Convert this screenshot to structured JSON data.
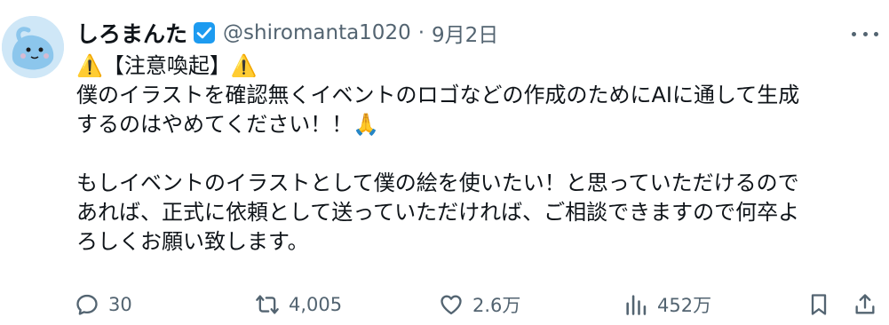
{
  "tweet": {
    "author_name": "しろまんた",
    "handle": "@shiromanta1020",
    "separator": "·",
    "date": "9月2日",
    "lines": [
      "⚠️【注意喚起】⚠️",
      "僕のイラストを確認無くイベントのロゴなどの作成のためにAIに通して生成",
      "するのはやめてください！！🙏",
      "",
      "もしイベントのイラストとして僕の絵を使いたい！と思っていただけるので",
      "あれば、正式に依頼として送っていただければ、ご相談できますので何卒よ",
      "ろしくお願い致します。"
    ]
  },
  "actions": {
    "replies": "30",
    "retweets": "4,005",
    "likes": "2.6万",
    "views": "452万"
  },
  "icons": {
    "more": "more-horizontal-icon",
    "reply": "reply-icon",
    "retweet": "retweet-icon",
    "like": "heart-icon",
    "views": "views-icon",
    "bookmark": "bookmark-icon",
    "share": "share-icon",
    "verified": "verified-badge-icon"
  },
  "colors": {
    "text": "#0f1419",
    "secondary": "#536471",
    "verified": "#1d9bf0",
    "avatar_bg": "#cfe7f7"
  }
}
